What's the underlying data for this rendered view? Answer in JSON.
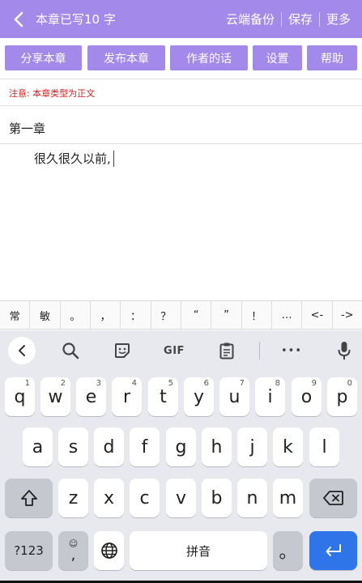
{
  "header": {
    "title": "本章已写10 字",
    "cloud_backup": "云端备份",
    "save": "保存",
    "more": "更多"
  },
  "actions": [
    "分享本章",
    "发布本章",
    "作者的话",
    "设置",
    "帮助"
  ],
  "notice": "注意: 本章类型为正文",
  "chapter_title": "第一章",
  "content_text": "很久很久以前,",
  "symbols": [
    "常",
    "敏",
    "。",
    "，",
    "：",
    "？",
    "“",
    "”",
    "！",
    "…",
    "<-",
    "->"
  ],
  "keyboard": {
    "toolbar_icons": [
      "chevron-left-icon",
      "search-icon",
      "sticker-icon",
      "gif-icon",
      "clipboard-icon",
      "more-icon",
      "mic-icon"
    ],
    "gif_label": "GIF",
    "more_label": "•••",
    "row1": [
      {
        "key": "q",
        "hint": "1"
      },
      {
        "key": "w",
        "hint": "2"
      },
      {
        "key": "e",
        "hint": "3"
      },
      {
        "key": "r",
        "hint": "4"
      },
      {
        "key": "t",
        "hint": "5"
      },
      {
        "key": "y",
        "hint": "6"
      },
      {
        "key": "u",
        "hint": "7"
      },
      {
        "key": "i",
        "hint": "8"
      },
      {
        "key": "o",
        "hint": "9"
      },
      {
        "key": "p",
        "hint": "0"
      }
    ],
    "row2": [
      "a",
      "s",
      "d",
      "f",
      "g",
      "h",
      "j",
      "k",
      "l"
    ],
    "row3": [
      "z",
      "x",
      "c",
      "v",
      "b",
      "n",
      "m"
    ],
    "symbols_key": "?123",
    "comma_key": ",",
    "space_label": "拼音",
    "period_key": "。",
    "accent_color": "#a389ea",
    "enter_color": "#2f74e8"
  }
}
